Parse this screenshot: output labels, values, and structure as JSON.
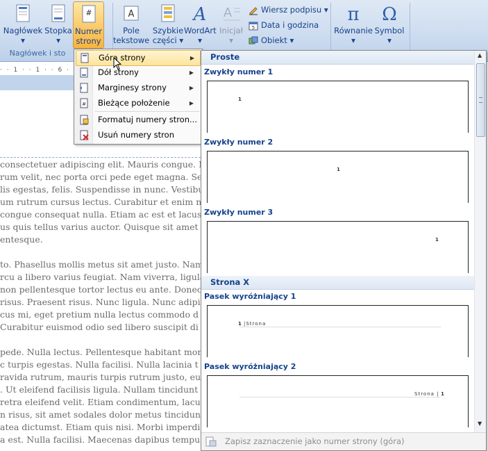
{
  "ribbon": {
    "buttons": [
      {
        "label": "Nagłówek"
      },
      {
        "label": "Stopka"
      },
      {
        "label": "Numer strony",
        "line1": "Numer",
        "line2": "strony"
      },
      {
        "label": "Pole tekstowe",
        "line1": "Pole",
        "line2": "tekstowe"
      },
      {
        "label": "Szybkie części",
        "line1": "Szybkie",
        "line2": "części"
      },
      {
        "label": "WordArt"
      },
      {
        "label": "Inicjał"
      },
      {
        "label": "Równanie"
      },
      {
        "label": "Symbol"
      }
    ],
    "small_buttons": [
      "Wiersz podpisu",
      "Data i godzina",
      "Obiekt"
    ],
    "group_label": "Nagłówek i sto"
  },
  "ruler": {
    "text": "· · 1 · · 1 · · 6 · · 1 · · 7 · · 1 · · 8 · · 1 · · 9 · · 1 · · 10 · · 1 · · 11 · · 1 · · 12 · · 1 · · 13 · · 1 · · 14 ·"
  },
  "menu": {
    "items": [
      {
        "label": "Góra strony",
        "has_submenu": true
      },
      {
        "label": "Dół strony",
        "has_submenu": true
      },
      {
        "label": "Marginesy strony",
        "has_submenu": true
      },
      {
        "label": "Bieżące położenie",
        "has_submenu": true
      },
      {
        "label": "Formatuj numery stron..."
      },
      {
        "label": "Usuń numery stron"
      }
    ]
  },
  "gallery": {
    "categories": [
      "Proste",
      "Strona X"
    ],
    "items": [
      {
        "title": "Zwykły numer 1",
        "num": "1"
      },
      {
        "title": "Zwykły numer 2",
        "num": "1"
      },
      {
        "title": "Zwykły numer 3",
        "num": "1"
      },
      {
        "title": "Pasek wyróżniający 1",
        "num": "1",
        "text": "Strona"
      },
      {
        "title": "Pasek wyróżniający 2",
        "num": "1",
        "text": "Strona"
      }
    ],
    "footer": "Zapisz zaznaczenie jako numer strony (góra)"
  },
  "document": {
    "paragraphs": [
      [
        "consectetuer adipiscing elit. Mauris congue. N",
        "rum velit, nec porta orci pede eget magna. Se",
        "lis egestas, felis. Suspendisse in nunc. Vestibu",
        "um rutrum cursus lectus. Curabitur et enim no",
        "congue consequat nulla. Etiam ac est et lacus",
        "us quis tellus varius auctor. Quisque sit amet",
        "entesque."
      ],
      [
        "to. Phasellus mollis metus sit amet justo. Nam",
        "rcu a libero varius feugiat. Nam viverra, ligula",
        "non pellentesque tortor lectus eu ante. Donec",
        "risus. Praesent risus. Nunc ligula. Nunc adipi",
        "cus mi, eget pretium nulla lectus commodo d",
        "Curabitur euismod odio sed libero suscipit di"
      ],
      [
        "pede. Nulla lectus. Pellentesque habitant morb",
        "c turpis egestas. Nulla facilisi. Nulla lacinia t",
        "ravida rutrum, mauris turpis rutrum justo, eu",
        ". Ut eleifend facilisis ligula. Nullam tincidunt",
        "retra eleifend velit. Etiam condimentum, lacu",
        "n risus, sit amet sodales dolor metus tincidun",
        "atea dictumst. Etiam quis nisi. Morbi imperdi",
        "a est. Nulla facilisi. Maecenas dapibus tempus"
      ]
    ]
  },
  "colors": {
    "accent": "#15428b",
    "highlight": "#fbc766"
  }
}
